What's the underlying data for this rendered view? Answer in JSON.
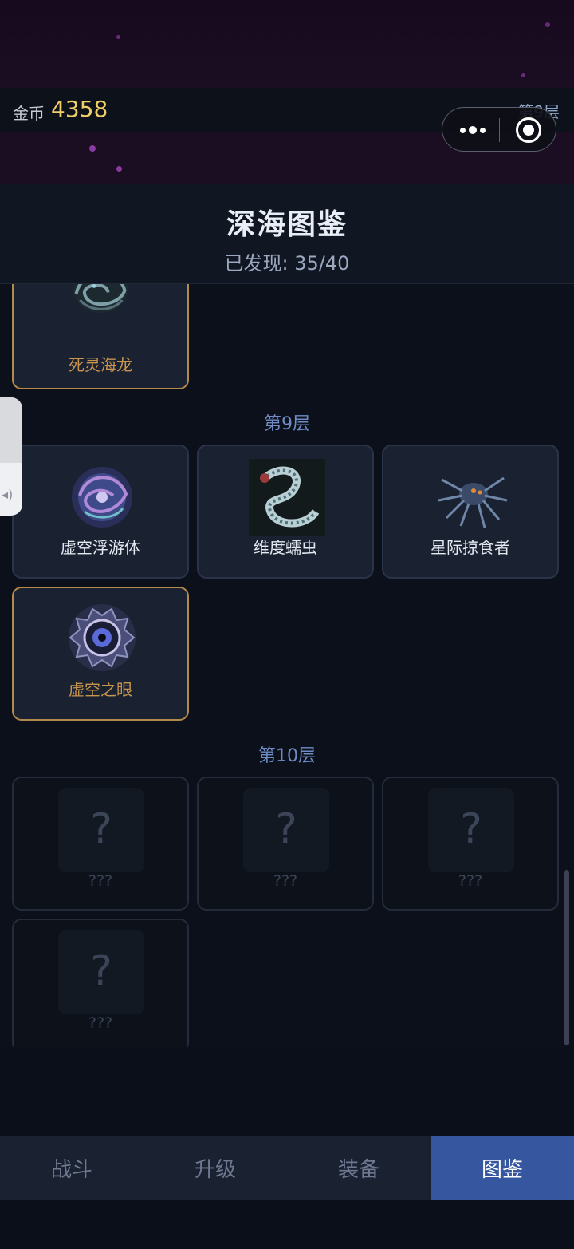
{
  "status": {
    "coin_label": "金币",
    "coin_value": "4358",
    "floor": "第9层"
  },
  "capsule": {
    "more_icon": "more-dots-icon",
    "close_icon": "target-circle-icon"
  },
  "header": {
    "title": "深海图鉴",
    "discovered": "已发现: 35/40"
  },
  "sections": [
    {
      "floor_label": "第9层"
    },
    {
      "floor_label": "第10层"
    }
  ],
  "cards": {
    "prev_gold": {
      "name": "死灵海龙",
      "art": "dragon-art-icon"
    },
    "f9_1": {
      "name": "虚空浮游体",
      "art": "void-orb-art-icon"
    },
    "f9_2": {
      "name": "维度蠕虫",
      "art": "worm-art-icon"
    },
    "f9_3": {
      "name": "星际掠食者",
      "art": "spider-art-icon"
    },
    "f9_boss": {
      "name": "虚空之眼",
      "art": "eye-art-icon"
    },
    "f10_1": {
      "name": "???",
      "mark": "?"
    },
    "f10_2": {
      "name": "???",
      "mark": "?"
    },
    "f10_3": {
      "name": "???",
      "mark": "?"
    },
    "f10_boss": {
      "name": "???",
      "mark": "?"
    }
  },
  "tabs": [
    {
      "label": "战斗",
      "active": false
    },
    {
      "label": "升级",
      "active": false
    },
    {
      "label": "装备",
      "active": false
    },
    {
      "label": "图鉴",
      "active": true
    }
  ],
  "colors": {
    "accent": "#3657a0",
    "gold": "#b48a4a",
    "coin": "#f0cf6a"
  }
}
